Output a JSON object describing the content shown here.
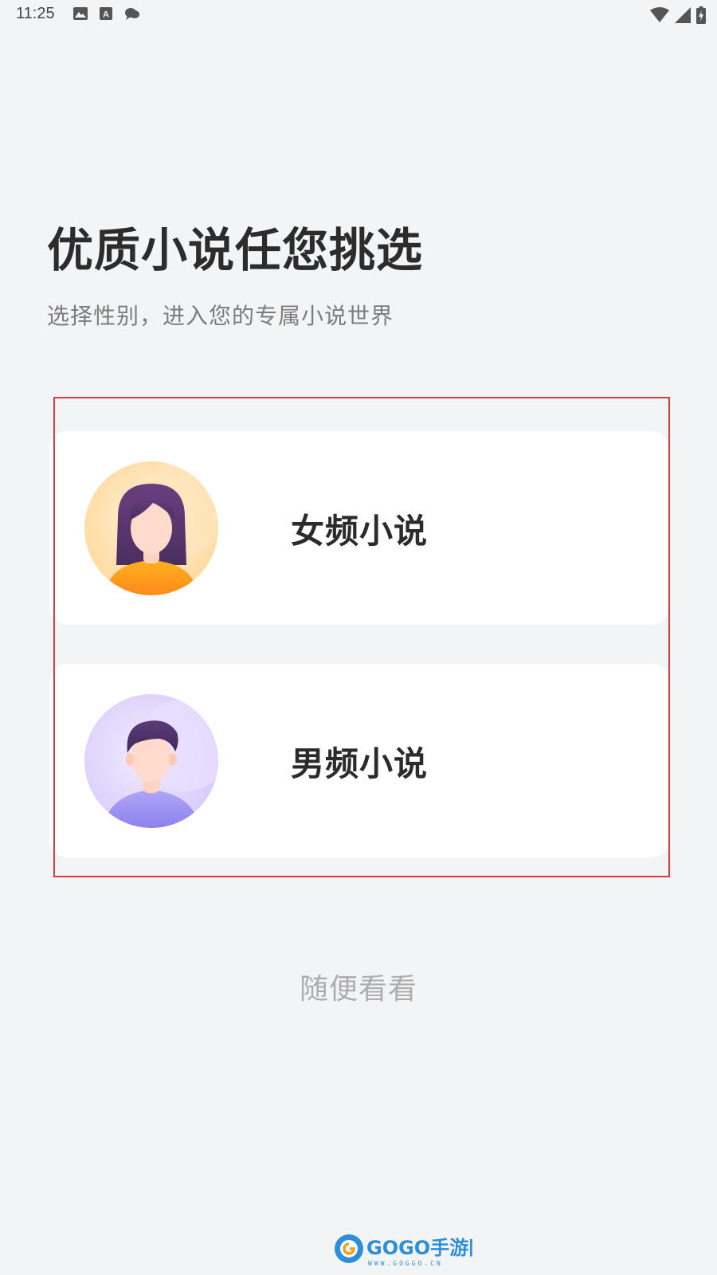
{
  "status_bar": {
    "time": "11:25",
    "left_icons": [
      "image-icon",
      "text-a-icon",
      "chat-icon"
    ],
    "right_icons": [
      "wifi-icon",
      "signal-icon",
      "battery-charging-icon"
    ]
  },
  "header": {
    "title": "优质小说任您挑选",
    "subtitle": "选择性别，进入您的专属小说世界"
  },
  "options": [
    {
      "label": "女频小说",
      "avatar": "female-avatar-icon",
      "accent": "#ffa42a"
    },
    {
      "label": "男频小说",
      "avatar": "male-avatar-icon",
      "accent": "#9d93f5"
    }
  ],
  "skip": {
    "label": "随便看看"
  },
  "watermark": {
    "brand": "GOGO手游网",
    "url": "WWW.GOGGO.CN"
  },
  "colors": {
    "background": "#f3f4f6",
    "card": "#ffffff",
    "highlight": "#dc3b3b",
    "title": "#2c2c2c",
    "subtitle": "#7c7c7c",
    "skip": "#adadad"
  }
}
